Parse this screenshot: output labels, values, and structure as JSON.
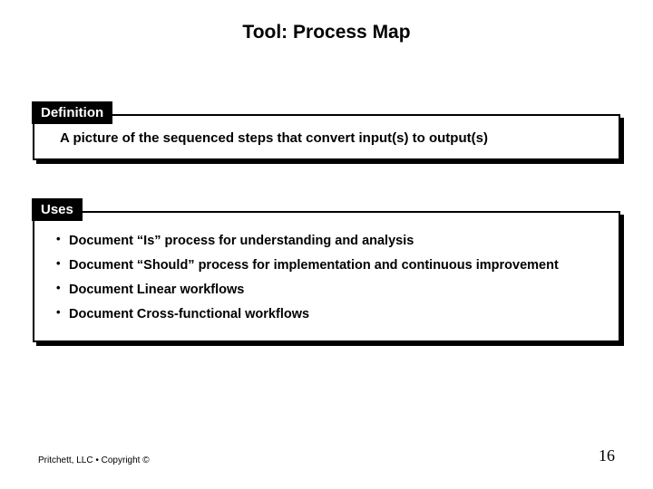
{
  "title": "Tool: Process Map",
  "sections": {
    "definition": {
      "label": "Definition",
      "text": "A picture of the sequenced steps that convert input(s) to output(s)"
    },
    "uses": {
      "label": "Uses",
      "items": [
        "Document “Is” process for understanding and analysis",
        "Document “Should” process for implementation and continuous improvement",
        "Document Linear workflows",
        "Document Cross-functional workflows"
      ]
    }
  },
  "footer": {
    "copyright": "Pritchett, LLC • Copyright ©",
    "page": "16"
  }
}
